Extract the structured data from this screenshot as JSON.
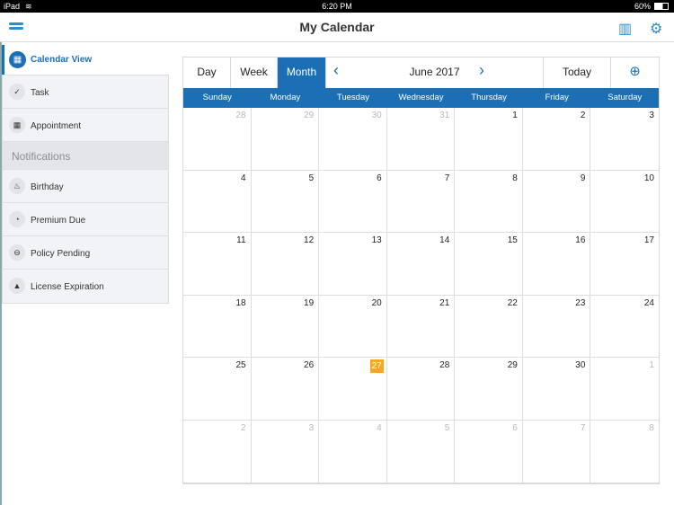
{
  "status": {
    "device": "iPad",
    "time": "6:20 PM",
    "battery": "60%"
  },
  "header": {
    "title": "My Calendar"
  },
  "sidebar": {
    "calendar_view": "Calendar View",
    "items": [
      {
        "label": "Task",
        "icon": "✓"
      },
      {
        "label": "Appointment",
        "icon": "▦"
      }
    ],
    "notifications_label": "Notifications",
    "notifications": [
      {
        "label": "Birthday",
        "icon": "♨"
      },
      {
        "label": "Premium Due",
        "icon": "◔"
      },
      {
        "label": "Policy Pending",
        "icon": "⊖"
      },
      {
        "label": "License Expiration",
        "icon": "▲"
      }
    ]
  },
  "toolbar": {
    "day": "Day",
    "week": "Week",
    "month": "Month",
    "current": "June 2017",
    "today": "Today",
    "add": "⊕",
    "prev": "‹",
    "next": "›"
  },
  "weekdays": [
    "Sunday",
    "Monday",
    "Tuesday",
    "Wednesday",
    "Thursday",
    "Friday",
    "Saturday"
  ],
  "days": [
    {
      "d": "28",
      "o": 1
    },
    {
      "d": "29",
      "o": 1
    },
    {
      "d": "30",
      "o": 1
    },
    {
      "d": "31",
      "o": 1
    },
    {
      "d": "1"
    },
    {
      "d": "2"
    },
    {
      "d": "3"
    },
    {
      "d": "4"
    },
    {
      "d": "5"
    },
    {
      "d": "6"
    },
    {
      "d": "7"
    },
    {
      "d": "8"
    },
    {
      "d": "9"
    },
    {
      "d": "10"
    },
    {
      "d": "11"
    },
    {
      "d": "12"
    },
    {
      "d": "13"
    },
    {
      "d": "14"
    },
    {
      "d": "15"
    },
    {
      "d": "16"
    },
    {
      "d": "17"
    },
    {
      "d": "18"
    },
    {
      "d": "19"
    },
    {
      "d": "20"
    },
    {
      "d": "21"
    },
    {
      "d": "22"
    },
    {
      "d": "23"
    },
    {
      "d": "24"
    },
    {
      "d": "25"
    },
    {
      "d": "26"
    },
    {
      "d": "27",
      "t": 1
    },
    {
      "d": "28"
    },
    {
      "d": "29"
    },
    {
      "d": "30"
    },
    {
      "d": "1",
      "o": 1
    },
    {
      "d": "2",
      "o": 1
    },
    {
      "d": "3",
      "o": 1
    },
    {
      "d": "4",
      "o": 1
    },
    {
      "d": "5",
      "o": 1
    },
    {
      "d": "6",
      "o": 1
    },
    {
      "d": "7",
      "o": 1
    },
    {
      "d": "8",
      "o": 1
    }
  ],
  "colors": {
    "accent": "#1a6fb5",
    "today": "#f5a623"
  }
}
